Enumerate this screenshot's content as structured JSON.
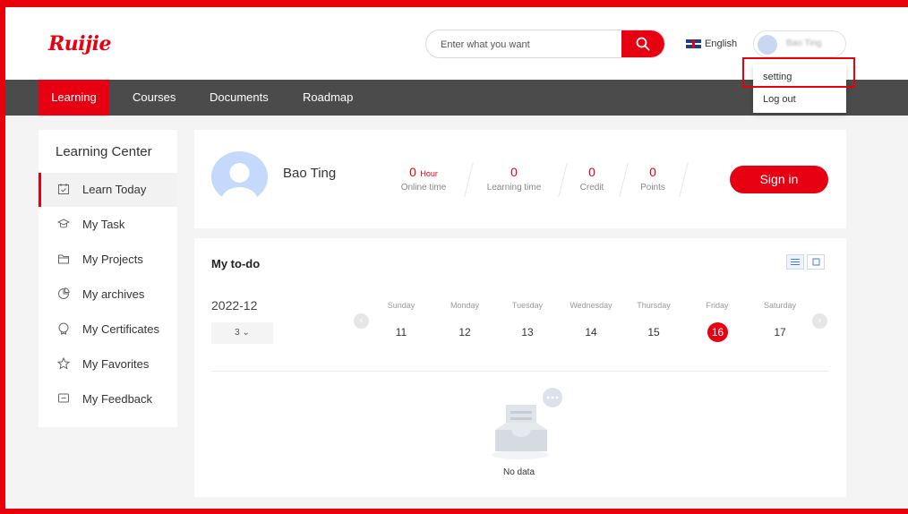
{
  "header": {
    "logo_text": "Ruijie",
    "search_placeholder": "Enter what you want",
    "language": "English",
    "user_name": "Bao Ting"
  },
  "user_menu": {
    "items": [
      {
        "label": "setting"
      },
      {
        "label": "Log out"
      }
    ]
  },
  "nav": {
    "tabs": [
      {
        "label": "Learning",
        "active": true
      },
      {
        "label": "Courses"
      },
      {
        "label": "Documents"
      },
      {
        "label": "Roadmap"
      }
    ]
  },
  "sidebar": {
    "title": "Learning Center",
    "items": [
      {
        "label": "Learn Today",
        "icon": "calendar-check-icon",
        "active": true
      },
      {
        "label": "My Task",
        "icon": "graduation-cap-icon"
      },
      {
        "label": "My Projects",
        "icon": "folder-icon"
      },
      {
        "label": "My archives",
        "icon": "pie-chart-icon"
      },
      {
        "label": "My Certificates",
        "icon": "medal-icon"
      },
      {
        "label": "My Favorites",
        "icon": "star-icon"
      },
      {
        "label": "My Feedback",
        "icon": "message-icon"
      }
    ]
  },
  "profile": {
    "name": "Bao Ting",
    "stats": [
      {
        "value": "0",
        "unit": "Hour",
        "label": "Online time"
      },
      {
        "value": "0",
        "unit": "",
        "label": "Learning time"
      },
      {
        "value": "0",
        "unit": "",
        "label": "Credit"
      },
      {
        "value": "0",
        "unit": "",
        "label": "Points"
      }
    ],
    "sign_in_label": "Sign in"
  },
  "todo": {
    "title": "My to-do",
    "month": "2022-12",
    "week_selected": "3",
    "days": [
      {
        "name": "Sunday",
        "date": "11"
      },
      {
        "name": "Monday",
        "date": "12"
      },
      {
        "name": "Tuesday",
        "date": "13"
      },
      {
        "name": "Wednesday",
        "date": "14"
      },
      {
        "name": "Thursday",
        "date": "15"
      },
      {
        "name": "Friday",
        "date": "16",
        "today": true
      },
      {
        "name": "Saturday",
        "date": "17"
      }
    ],
    "empty_text": "No data"
  },
  "colors": {
    "accent": "#e60012",
    "nav_bg": "#4b4b4b",
    "page_bg": "#f4f4f4",
    "highlight_border": "#e8000b"
  }
}
